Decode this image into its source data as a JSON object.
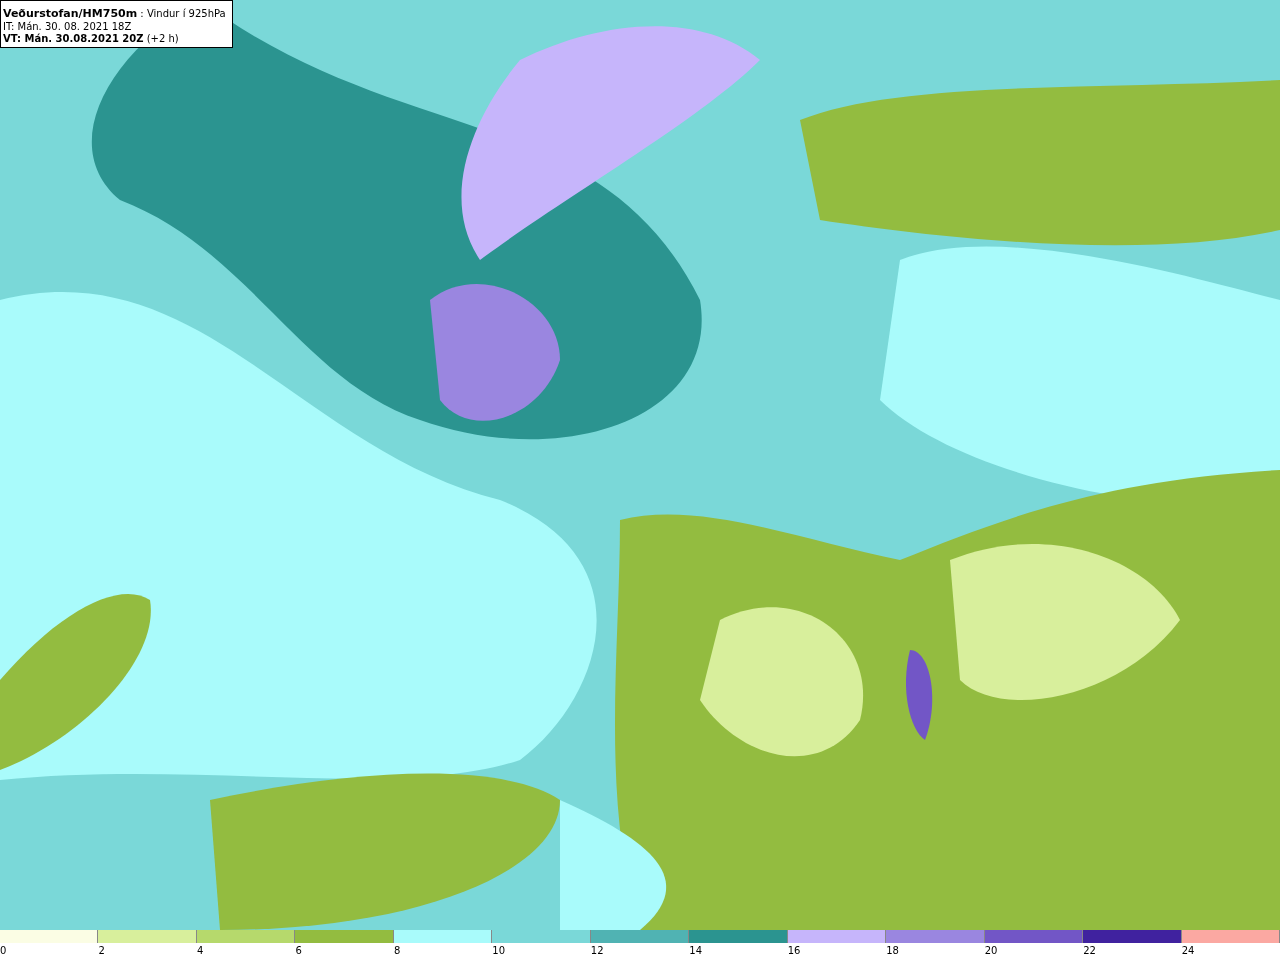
{
  "header": {
    "title": "**Veðurstofan/HM750m** : Vindur í 925hPa",
    "issue_time": "IT: Mán. 30. 08. 2021 18Z",
    "valid_time": "**VT: Mán. 30.08.2021 20Z** (+2 h)"
  },
  "legend": {
    "bins": [
      {
        "color": "#fbfde4"
      },
      {
        "color": "#d8ef9c"
      },
      {
        "color": "#b6d96c"
      },
      {
        "color": "#93bc40"
      },
      {
        "color": "#a9fbfb"
      },
      {
        "color": "#7ad8d8"
      },
      {
        "color": "#50b3b3"
      },
      {
        "color": "#2b9490"
      },
      {
        "color": "#c6b5fb"
      },
      {
        "color": "#9a86e0"
      },
      {
        "color": "#7256c6"
      },
      {
        "color": "#40229f"
      },
      {
        "color": "#fba8a2"
      }
    ],
    "ticks": [
      "0",
      "2",
      "4",
      "6",
      "8",
      "10",
      "12",
      "14",
      "16",
      "18",
      "20",
      "22",
      "24"
    ]
  }
}
